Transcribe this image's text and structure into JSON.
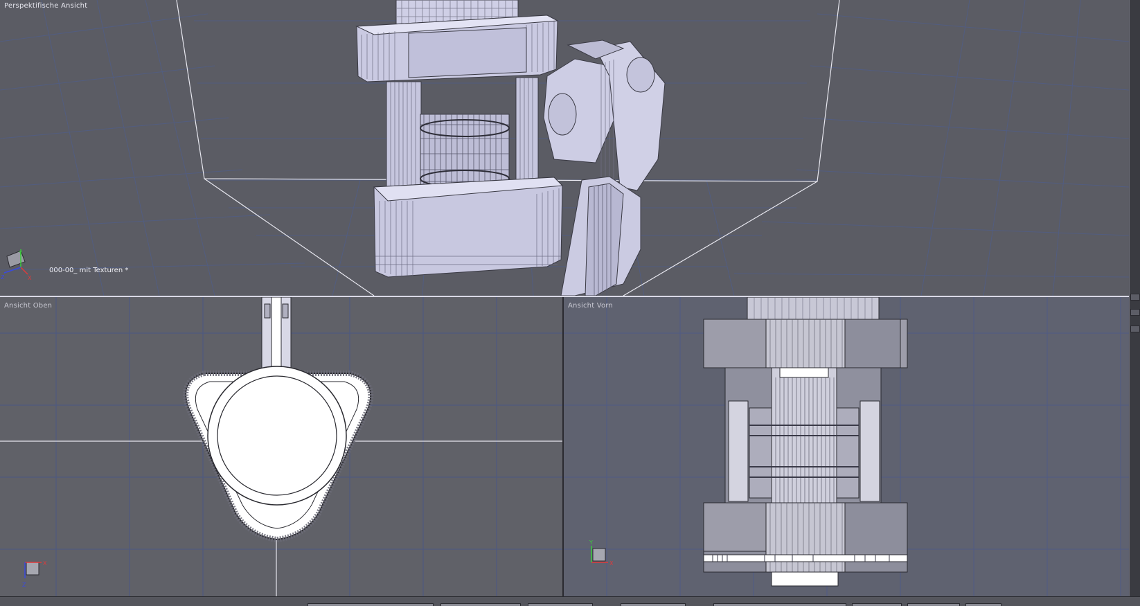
{
  "viewports": {
    "perspective": {
      "label": "Perspektifische Ansicht",
      "scene_name": "000-00_ mit Texturen *"
    },
    "top": {
      "label": "Ansicht Oben"
    },
    "front": {
      "label": "Ansicht Vorn"
    }
  },
  "axis_labels": {
    "x": "X",
    "y": "Y",
    "z": "Z"
  },
  "icons": [
    "axis-gizmo-icon",
    "viewport-divider-handle-icon",
    "scroll-arrow-icon"
  ],
  "colors": {
    "perspective_bg": "#5b5c64",
    "top_bg": "#606168",
    "front_bg": "#5f6270",
    "mesh_fill": "#d4d4ea",
    "wire": "#3c3c46",
    "axis_x": "#e03a3a",
    "axis_y": "#3acd3a",
    "axis_z": "#3a4ae0"
  }
}
